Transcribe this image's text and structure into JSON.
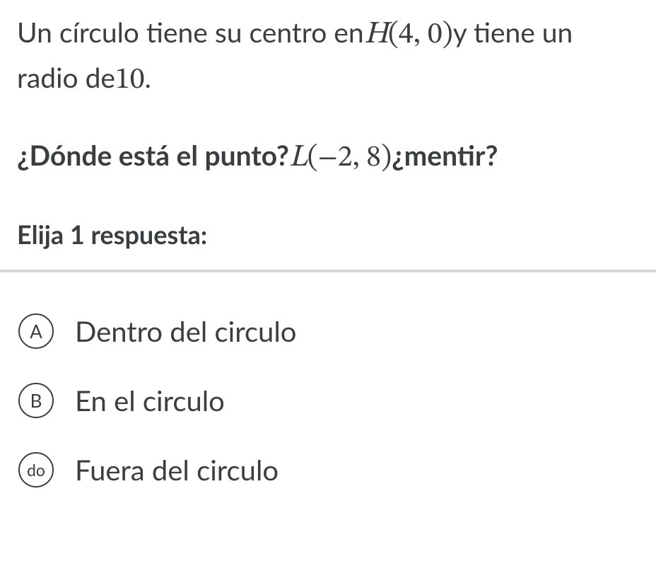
{
  "p1": {
    "t1": "Un círculo tiene su centro en",
    "center_var": "H",
    "lp": "(",
    "cx": "4",
    "comma": ",",
    "cy": "0",
    "rp": ")",
    "t2": "y tiene un radio de",
    "radius": "10",
    "period": "."
  },
  "q": {
    "t1": "¿Dónde está el punto?",
    "pvar": "L",
    "lp": "(",
    "minus": "−",
    "px": "2",
    "comma": ",",
    "py": "8",
    "rp": ")",
    "t2": "¿mentir?"
  },
  "instruction": "Elija 1 respuesta:",
  "options": {
    "a": {
      "letter": "A",
      "text": "Dentro del circulo"
    },
    "b": {
      "letter": "B",
      "text": "En el circulo"
    },
    "c": {
      "letter": "do",
      "text": "Fuera del circulo"
    }
  }
}
